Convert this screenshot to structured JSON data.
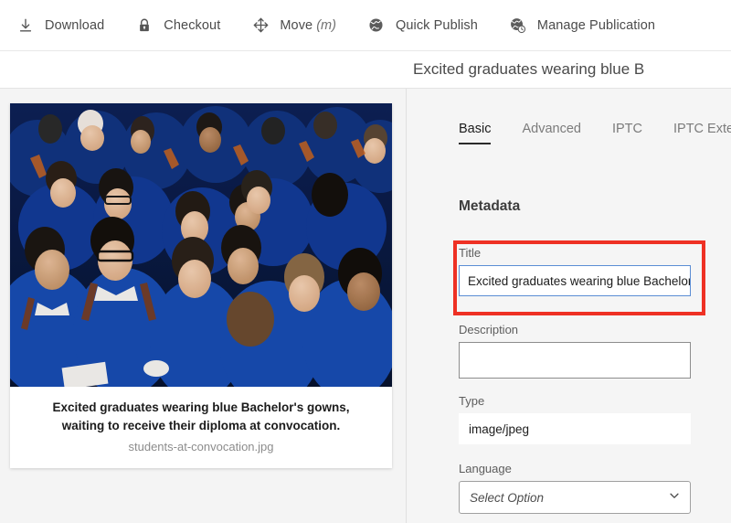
{
  "toolbar": {
    "items": [
      {
        "label": "Download",
        "icon": "download-icon",
        "shortcut": ""
      },
      {
        "label": "Checkout",
        "icon": "lock-icon",
        "shortcut": ""
      },
      {
        "label": "Move",
        "icon": "move-icon",
        "shortcut": "(m)"
      },
      {
        "label": "Quick Publish",
        "icon": "globe-icon",
        "shortcut": ""
      },
      {
        "label": "Manage Publication",
        "icon": "globe-clock-icon",
        "shortcut": ""
      }
    ]
  },
  "header": {
    "title": "Excited graduates wearing blue B"
  },
  "asset": {
    "caption": "Excited graduates wearing blue Bachelor's gowns, waiting to receive their diploma at convocation.",
    "filename": "students-at-convocation.jpg",
    "alt": "Crowd of university graduates in blue gowns looking upward and smiling"
  },
  "tabs": [
    {
      "label": "Basic",
      "active": true
    },
    {
      "label": "Advanced",
      "active": false
    },
    {
      "label": "IPTC",
      "active": false
    },
    {
      "label": "IPTC Exten",
      "active": false
    }
  ],
  "metadata": {
    "section_title": "Metadata",
    "title_label": "Title",
    "title_value": "Excited graduates wearing blue Bachelor'",
    "description_label": "Description",
    "description_value": "",
    "type_label": "Type",
    "type_value": "image/jpeg",
    "language_label": "Language",
    "language_placeholder": "Select Option",
    "language_chevron": "chevron-down-icon"
  },
  "colors": {
    "highlight_red": "#ee3124",
    "focus_blue": "#5b8dd4",
    "panel_bg": "#f5f5f5",
    "gown_blue": "#12378f"
  }
}
